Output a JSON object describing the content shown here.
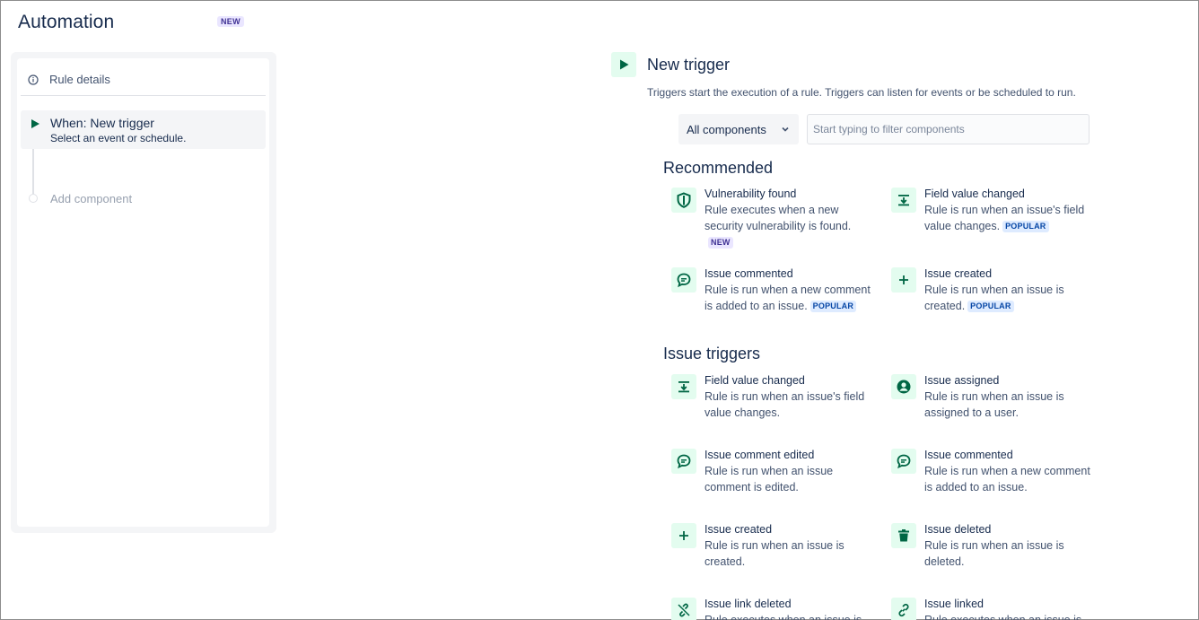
{
  "page": {
    "title": "Automation",
    "badge": "NEW"
  },
  "sidebar": {
    "rule_details": "Rule details",
    "trigger": {
      "title": "When: New trigger",
      "subtitle": "Select an event or schedule."
    },
    "add_component": "Add component"
  },
  "main": {
    "title": "New trigger",
    "description": "Triggers start the execution of a rule. Triggers can listen for events or be scheduled to run.",
    "filter": {
      "select_value": "All components",
      "input_placeholder": "Start typing to filter components"
    },
    "recommended": {
      "heading": "Recommended",
      "items": [
        {
          "title": "Vulnerability found",
          "desc": "Rule executes when a new security vulnerability is found.",
          "badge": "NEW",
          "icon": "shield-icon"
        },
        {
          "title": "Field value changed",
          "desc": "Rule is run when an issue's field value changes.",
          "badge": "POPULAR",
          "icon": "field-change-icon"
        },
        {
          "title": "Issue commented",
          "desc": "Rule is run when a new comment is added to an issue.",
          "badge": "POPULAR",
          "icon": "comment-icon"
        },
        {
          "title": "Issue created",
          "desc": "Rule is run when an issue is created.",
          "badge": "POPULAR",
          "icon": "plus-icon"
        }
      ]
    },
    "issue_triggers": {
      "heading": "Issue triggers",
      "items": [
        {
          "title": "Field value changed",
          "desc": "Rule is run when an issue's field value changes.",
          "icon": "field-change-icon"
        },
        {
          "title": "Issue assigned",
          "desc": "Rule is run when an issue is assigned to a user.",
          "icon": "user-icon"
        },
        {
          "title": "Issue comment edited",
          "desc": "Rule is run when an issue comment is edited.",
          "icon": "comment-icon"
        },
        {
          "title": "Issue commented",
          "desc": "Rule is run when a new comment is added to an issue.",
          "icon": "comment-icon"
        },
        {
          "title": "Issue created",
          "desc": "Rule is run when an issue is created.",
          "icon": "plus-icon"
        },
        {
          "title": "Issue deleted",
          "desc": "Rule is run when an issue is deleted.",
          "icon": "trash-icon"
        },
        {
          "title": "Issue link deleted",
          "desc": "Rule executes when an issue is",
          "icon": "unlink-icon"
        },
        {
          "title": "Issue linked",
          "desc": "Rule executes when an issue is",
          "icon": "link-icon"
        }
      ]
    }
  },
  "colors": {
    "accent_green": "#006644",
    "icon_bg": "#e3fcef",
    "text": "#172b4d",
    "popular_bg": "#deebff",
    "new_bg": "#eae6ff"
  }
}
